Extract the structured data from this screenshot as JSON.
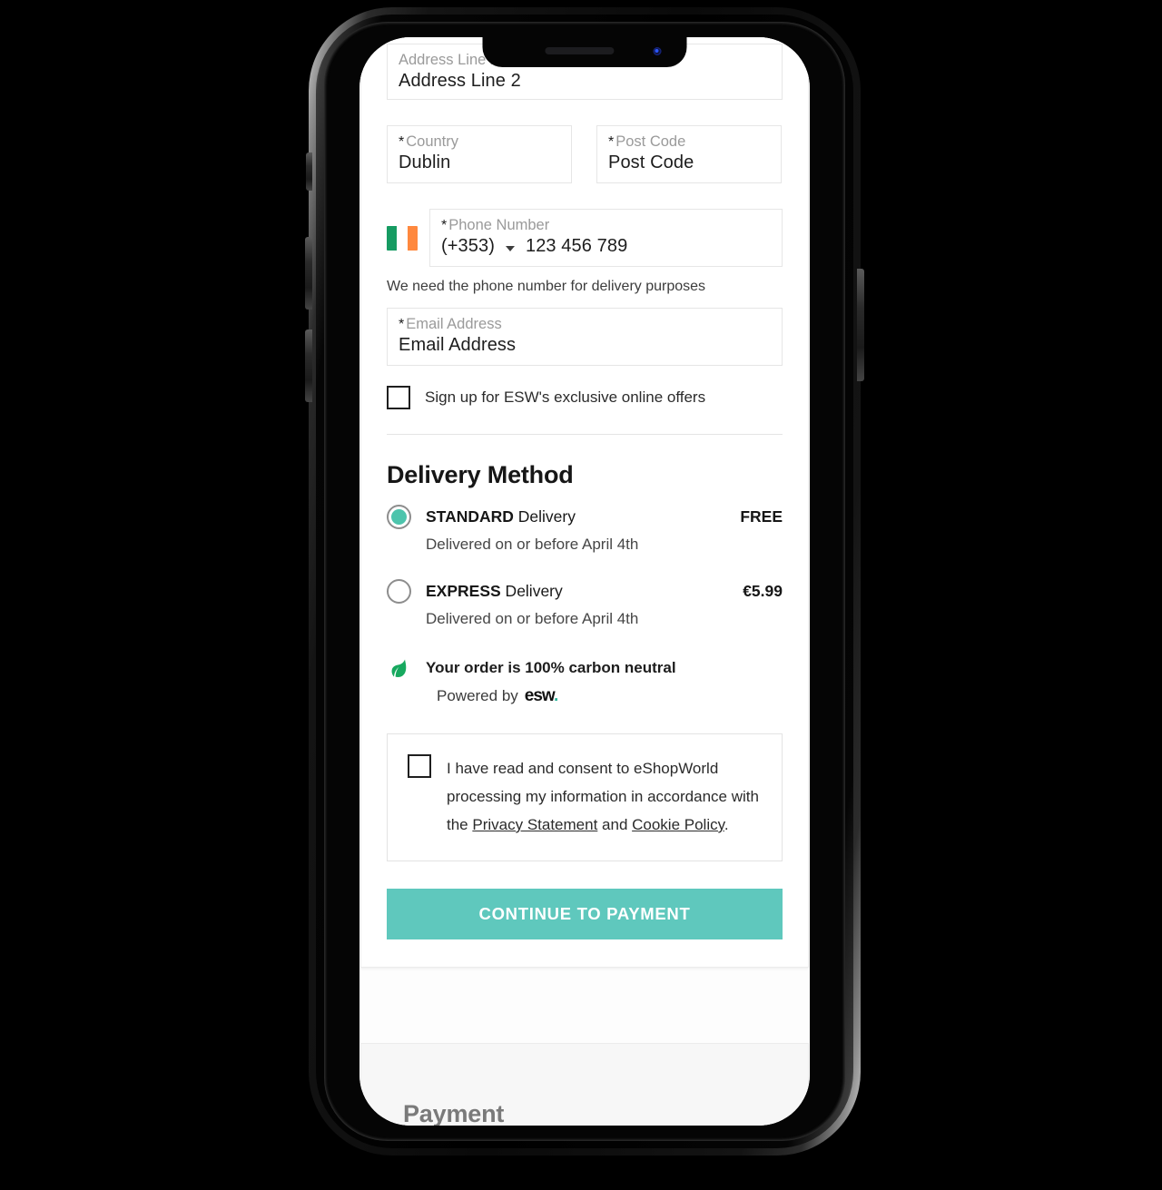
{
  "form": {
    "address2": {
      "label": "Address Line 2",
      "value": "Address Line 2",
      "required": false
    },
    "country": {
      "label": "Country",
      "value": "Dublin",
      "required": true,
      "star": "*"
    },
    "postcode": {
      "label": "Post Code",
      "value": "Post Code",
      "required": true,
      "star": "*"
    },
    "phone": {
      "label": "Phone Number",
      "star": "*",
      "dial_code": "(+353)",
      "value": "123 456 789",
      "flag": "ireland-flag-icon",
      "help_text": "We need the phone number for delivery purposes"
    },
    "email": {
      "label": "Email Address",
      "value": "Email Address",
      "star": "*"
    },
    "newsletter": {
      "label": "Sign up for ESW's exclusive online offers",
      "checked": false
    }
  },
  "delivery": {
    "title": "Delivery Method",
    "options": [
      {
        "name_bold": "STANDARD",
        "name_rest": " Delivery",
        "price": "FREE",
        "eta": "Delivered on or before April 4th",
        "selected": true
      },
      {
        "name_bold": "EXPRESS",
        "name_rest": " Delivery",
        "price": "€5.99",
        "eta": "Delivered on or before April 4th",
        "selected": false
      }
    ],
    "carbon": {
      "icon": "leaf-icon",
      "text": "Your order is 100% carbon neutral",
      "powered_by_label": "Powered by",
      "brand": "esw",
      "brand_dot": "."
    }
  },
  "consent": {
    "checked": false,
    "text_part1": "I have read and consent to eShopWorld processing my information in accordance with the ",
    "link_privacy": "Privacy Statement",
    "text_part2": " and ",
    "link_cookie": "Cookie Policy",
    "text_part3": "."
  },
  "actions": {
    "continue_label": "CONTINUE TO PAYMENT"
  },
  "payment": {
    "title": "Payment"
  },
  "colors": {
    "accent_teal": "#5fc8bd",
    "radio_fill": "#4dc4ac",
    "leaf_green": "#17a95f",
    "flag_green": "#169b62",
    "flag_orange": "#ff883e",
    "payment_title": "#7a7a7a"
  }
}
